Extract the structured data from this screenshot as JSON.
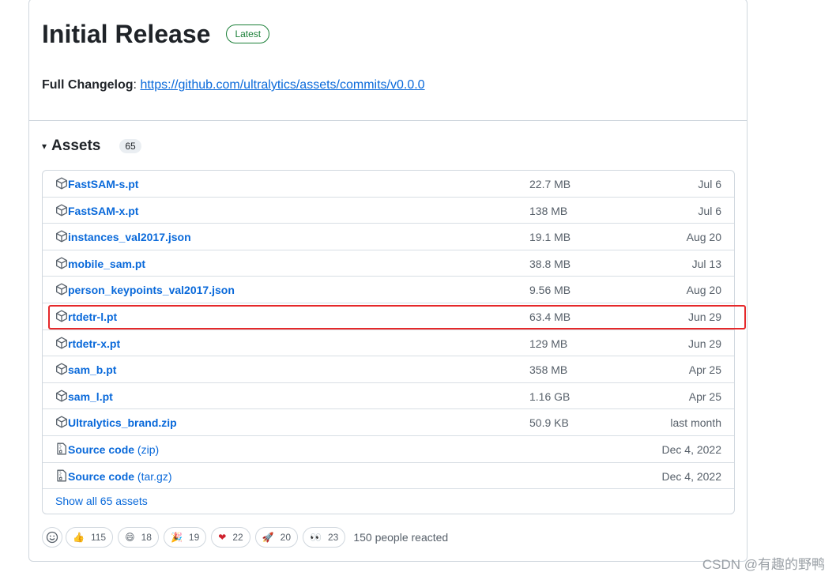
{
  "release": {
    "title": "Initial Release",
    "badge": "Latest",
    "changelog_label": "Full Changelog",
    "changelog_sep": ": ",
    "changelog_link": "https://github.com/ultralytics/assets/commits/v0.0.0"
  },
  "assets": {
    "caret": "▾",
    "title": "Assets",
    "count": "65",
    "rows": [
      {
        "name": "FastSAM-s.pt",
        "size": "22.7 MB",
        "date": "Jul 6",
        "icon": "package-icon"
      },
      {
        "name": "FastSAM-x.pt",
        "size": "138 MB",
        "date": "Jul 6",
        "icon": "package-icon"
      },
      {
        "name": "instances_val2017.json",
        "size": "19.1 MB",
        "date": "Aug 20",
        "icon": "package-icon"
      },
      {
        "name": "mobile_sam.pt",
        "size": "38.8 MB",
        "date": "Jul 13",
        "icon": "package-icon"
      },
      {
        "name": "person_keypoints_val2017.json",
        "size": "9.56 MB",
        "date": "Aug 20",
        "icon": "package-icon"
      },
      {
        "name": "rtdetr-l.pt",
        "size": "63.4 MB",
        "date": "Jun 29",
        "icon": "package-icon"
      },
      {
        "name": "rtdetr-x.pt",
        "size": "129 MB",
        "date": "Jun 29",
        "icon": "package-icon"
      },
      {
        "name": "sam_b.pt",
        "size": "358 MB",
        "date": "Apr 25",
        "icon": "package-icon"
      },
      {
        "name": "sam_l.pt",
        "size": "1.16 GB",
        "date": "Apr 25",
        "icon": "package-icon"
      },
      {
        "name": "Ultralytics_brand.zip",
        "size": "50.9 KB",
        "date": "last month",
        "icon": "package-icon"
      },
      {
        "name": "Source code",
        "paren": " (zip)",
        "size": "",
        "date": "Dec 4, 2022",
        "icon": "file-zip-icon"
      },
      {
        "name": "Source code",
        "paren": " (tar.gz)",
        "size": "",
        "date": "Dec 4, 2022",
        "icon": "file-zip-icon"
      }
    ],
    "show_all": "Show all 65 assets"
  },
  "reactions": {
    "items": [
      {
        "emoji": "👍",
        "count": "115",
        "icon": "thumbs-up-icon"
      },
      {
        "emoji": "😄",
        "count": "18",
        "icon": "smile-icon"
      },
      {
        "emoji": "🎉",
        "count": "19",
        "icon": "tada-icon"
      },
      {
        "emoji": "❤",
        "count": "22",
        "icon": "heart-icon"
      },
      {
        "emoji": "🚀",
        "count": "20",
        "icon": "rocket-icon"
      },
      {
        "emoji": "👀",
        "count": "23",
        "icon": "eyes-icon"
      }
    ],
    "summary": "150 people reacted"
  },
  "watermark": "CSDN @有趣的野鸭",
  "colors": {
    "link": "#0969da",
    "highlight": "#e5282a",
    "latest": "#1a7f37"
  }
}
